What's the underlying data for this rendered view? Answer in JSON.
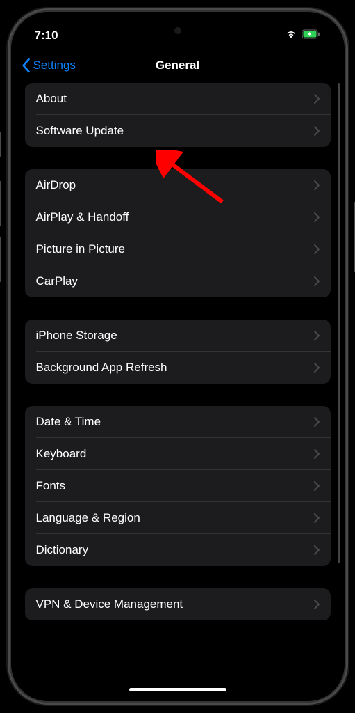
{
  "status_bar": {
    "time": "7:10"
  },
  "nav": {
    "back_label": "Settings",
    "title": "General"
  },
  "groups": [
    {
      "items": [
        {
          "label": "About"
        },
        {
          "label": "Software Update"
        }
      ]
    },
    {
      "items": [
        {
          "label": "AirDrop"
        },
        {
          "label": "AirPlay & Handoff"
        },
        {
          "label": "Picture in Picture"
        },
        {
          "label": "CarPlay"
        }
      ]
    },
    {
      "items": [
        {
          "label": "iPhone Storage"
        },
        {
          "label": "Background App Refresh"
        }
      ]
    },
    {
      "items": [
        {
          "label": "Date & Time"
        },
        {
          "label": "Keyboard"
        },
        {
          "label": "Fonts"
        },
        {
          "label": "Language & Region"
        },
        {
          "label": "Dictionary"
        }
      ]
    },
    {
      "items": [
        {
          "label": "VPN & Device Management"
        }
      ]
    }
  ],
  "annotation": {
    "type": "arrow",
    "target": "Software Update",
    "color": "#ff0000"
  }
}
